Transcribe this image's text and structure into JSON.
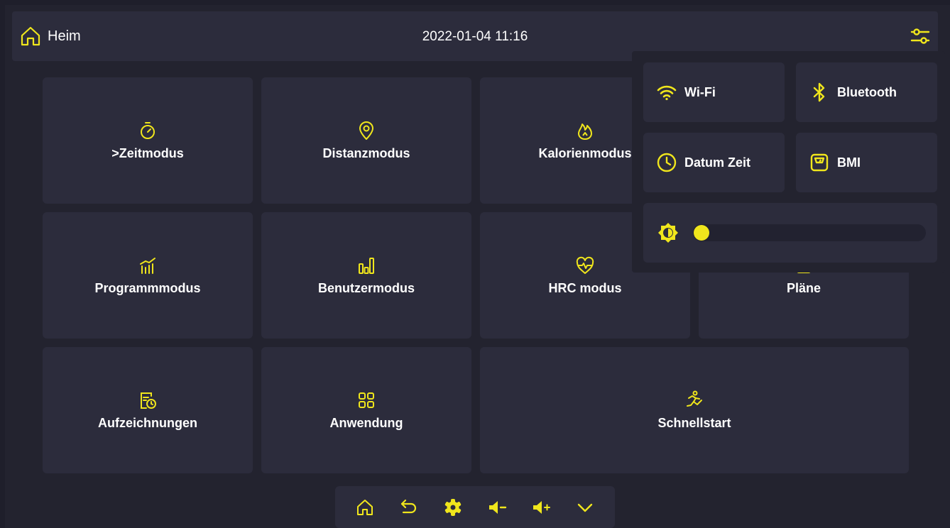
{
  "accent_color": "#f0e61c",
  "header": {
    "home_label": "Heim",
    "home_icon": "home-icon",
    "datetime": "2022-01-04 11:16",
    "settings_icon": "sliders-icon"
  },
  "tiles": [
    {
      "label": ">Zeitmodus",
      "icon": "stopwatch-icon"
    },
    {
      "label": "Distanzmodus",
      "icon": "location-pin-icon"
    },
    {
      "label": "Kalorienmodus",
      "icon": "flame-icon"
    },
    {
      "label": "Programmmodus",
      "icon": "chart-bars-trend-icon"
    },
    {
      "label": "Benutzermodus",
      "icon": "bar-chart-icon"
    },
    {
      "label": "HRC modus",
      "icon": "heart-pulse-icon"
    },
    {
      "label": "Pläne",
      "icon": "plan-icon"
    },
    {
      "label": "Aufzeichnungen",
      "icon": "record-clock-icon"
    },
    {
      "label": "Anwendung",
      "icon": "apps-grid-icon"
    },
    {
      "label": "Schnellstart",
      "icon": "runner-icon"
    }
  ],
  "quick_panel": {
    "buttons": [
      {
        "label": "Wi-Fi",
        "icon": "wifi-icon"
      },
      {
        "label": "Bluetooth",
        "icon": "bluetooth-icon"
      },
      {
        "label": "Datum Zeit",
        "icon": "clock-icon"
      },
      {
        "label": "BMI",
        "icon": "scale-icon"
      }
    ],
    "brightness": {
      "icon": "brightness-icon",
      "level": 0.0
    }
  },
  "bottom_bar": [
    {
      "icon": "home-icon"
    },
    {
      "icon": "back-icon"
    },
    {
      "icon": "gear-icon"
    },
    {
      "icon": "volume-down-icon"
    },
    {
      "icon": "volume-up-icon"
    },
    {
      "icon": "chevron-down-icon"
    }
  ]
}
